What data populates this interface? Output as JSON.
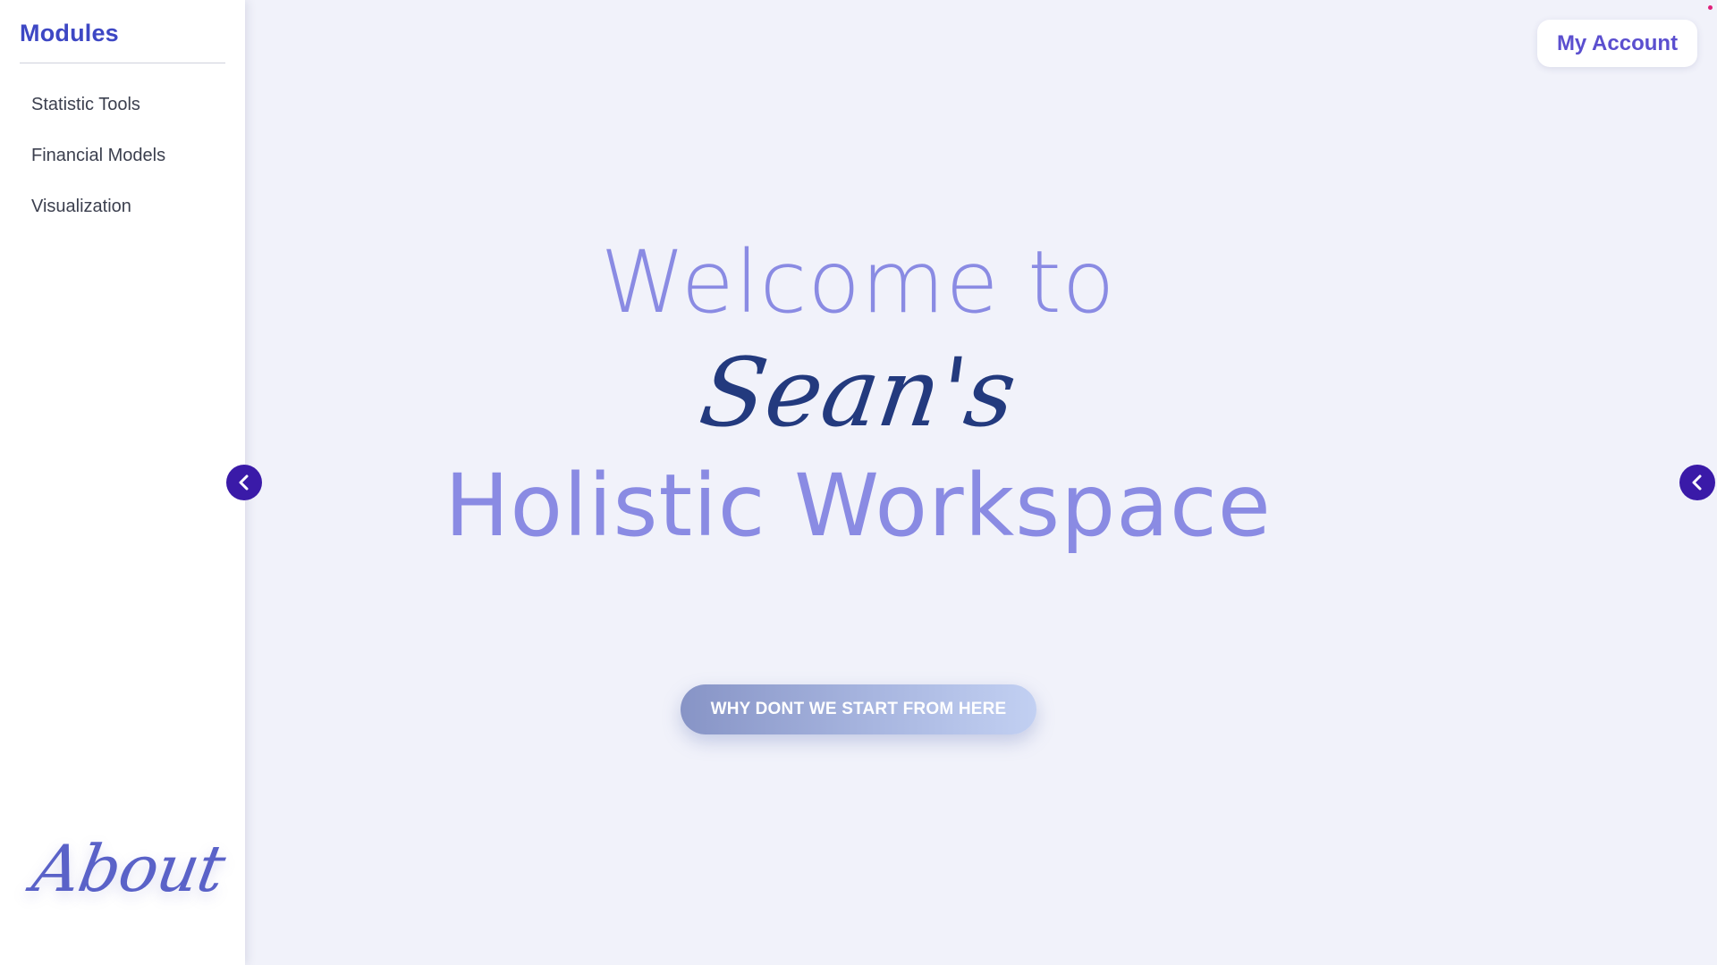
{
  "sidebar": {
    "title": "Modules",
    "items": [
      {
        "label": "Statistic Tools"
      },
      {
        "label": "Financial Models"
      },
      {
        "label": "Visualization"
      }
    ],
    "about_label": "About"
  },
  "header": {
    "account_label": "My Account"
  },
  "hero": {
    "line1": "Welcome to",
    "name": "Sean's",
    "line3": "Holistic Workspace",
    "cta_label": "WHY DONT WE START FROM HERE"
  },
  "icons": {
    "toggle": "chevron-left-icon"
  },
  "colors": {
    "accent": "#3d47c4",
    "toggle_bg": "#3a1aa8",
    "hero_text": "#8a8be3",
    "hero_name": "#233a7e",
    "account_text": "#5b4fcf",
    "background": "#f1f2fa"
  }
}
